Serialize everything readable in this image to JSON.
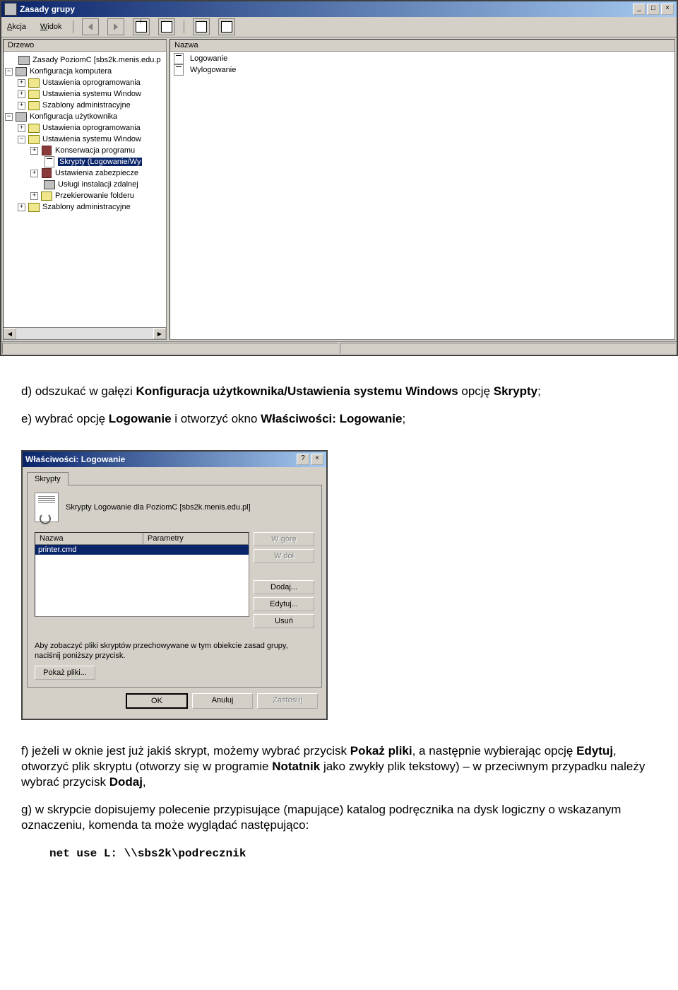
{
  "gp_window": {
    "title": "Zasady grupy",
    "minimize": "_",
    "maximize": "□",
    "close": "×",
    "menu": {
      "akcja": "Akcja",
      "widok": "Widok"
    },
    "left_header": "Drzewo",
    "right_header": "Nazwa",
    "tree": {
      "root": "Zasady PoziomC [sbs2k.menis.edu.p",
      "comp_conf": "Konfiguracja komputera",
      "comp_soft": "Ustawienia oprogramowania",
      "comp_win": "Ustawienia systemu Window",
      "comp_admin": "Szablony administracyjne",
      "user_conf": "Konfiguracja użytkownika",
      "user_soft": "Ustawienia oprogramowania",
      "user_win": "Ustawienia systemu Window",
      "konserwacja": "Konserwacja programu",
      "skrypty": "Skrypty (Logowanie/Wy",
      "zabezp": "Ustawienia zabezpiecze",
      "uslugi": "Usługi instalacji zdalnej",
      "przekier": "Przekierowanie folderu",
      "user_admin": "Szablony administracyjne"
    },
    "list": {
      "logowanie": "Logowanie",
      "wylogowanie": "Wylogowanie"
    }
  },
  "doc": {
    "p1_a": "d) odszukać w gałęzi ",
    "p1_b": "Konfiguracja użytkownika/Ustawienia systemu Windows",
    "p1_c": " opcję ",
    "p1_d": "Skrypty",
    "p1_e": ";",
    "p2_a": "e) wybrać opcję ",
    "p2_b": "Logowanie",
    "p2_c": " i otworzyć okno ",
    "p2_d": "Właściwości: Logowanie",
    "p2_e": ";",
    "p3_a": "f) jeżeli w oknie jest już jakiś skrypt, możemy wybrać przycisk ",
    "p3_b": "Pokaż pliki",
    "p3_c": ", a następnie wybierając opcję ",
    "p3_d": "Edytuj",
    "p3_e": ", otworzyć plik skryptu (otworzy się w programie ",
    "p3_f": "Notatnik",
    "p3_g": " jako zwykły plik tekstowy) – w przeciwnym przypadku należy wybrać przycisk ",
    "p3_h": "Dodaj",
    "p3_i": ",",
    "p4": "g) w skrypcie dopisujemy polecenie przypisujące (mapujące) katalog podręcznika na dysk logiczny o wskazanym oznaczeniu, komenda ta może wyglądać następująco:",
    "cmd": "net use L: \\\\sbs2k\\podrecznik"
  },
  "dlg": {
    "title": "Właściwości: Logowanie",
    "help": "?",
    "close": "×",
    "tab": "Skrypty",
    "desc": "Skrypty Logowanie dla PoziomC [sbs2k.menis.edu.pl]",
    "col_name": "Nazwa",
    "col_param": "Parametry",
    "script_row": "printer.cmd",
    "btn_up": "W górę",
    "btn_down": "W dół",
    "btn_add": "Dodaj...",
    "btn_edit": "Edytuj...",
    "btn_del": "Usuń",
    "help_text": "Aby zobaczyć pliki skryptów przechowywane w tym obiekcie zasad grupy, naciśnij poniższy przycisk.",
    "btn_show": "Pokaż pliki...",
    "btn_ok": "OK",
    "btn_cancel": "Anuluj",
    "btn_apply": "Zastosuj"
  }
}
